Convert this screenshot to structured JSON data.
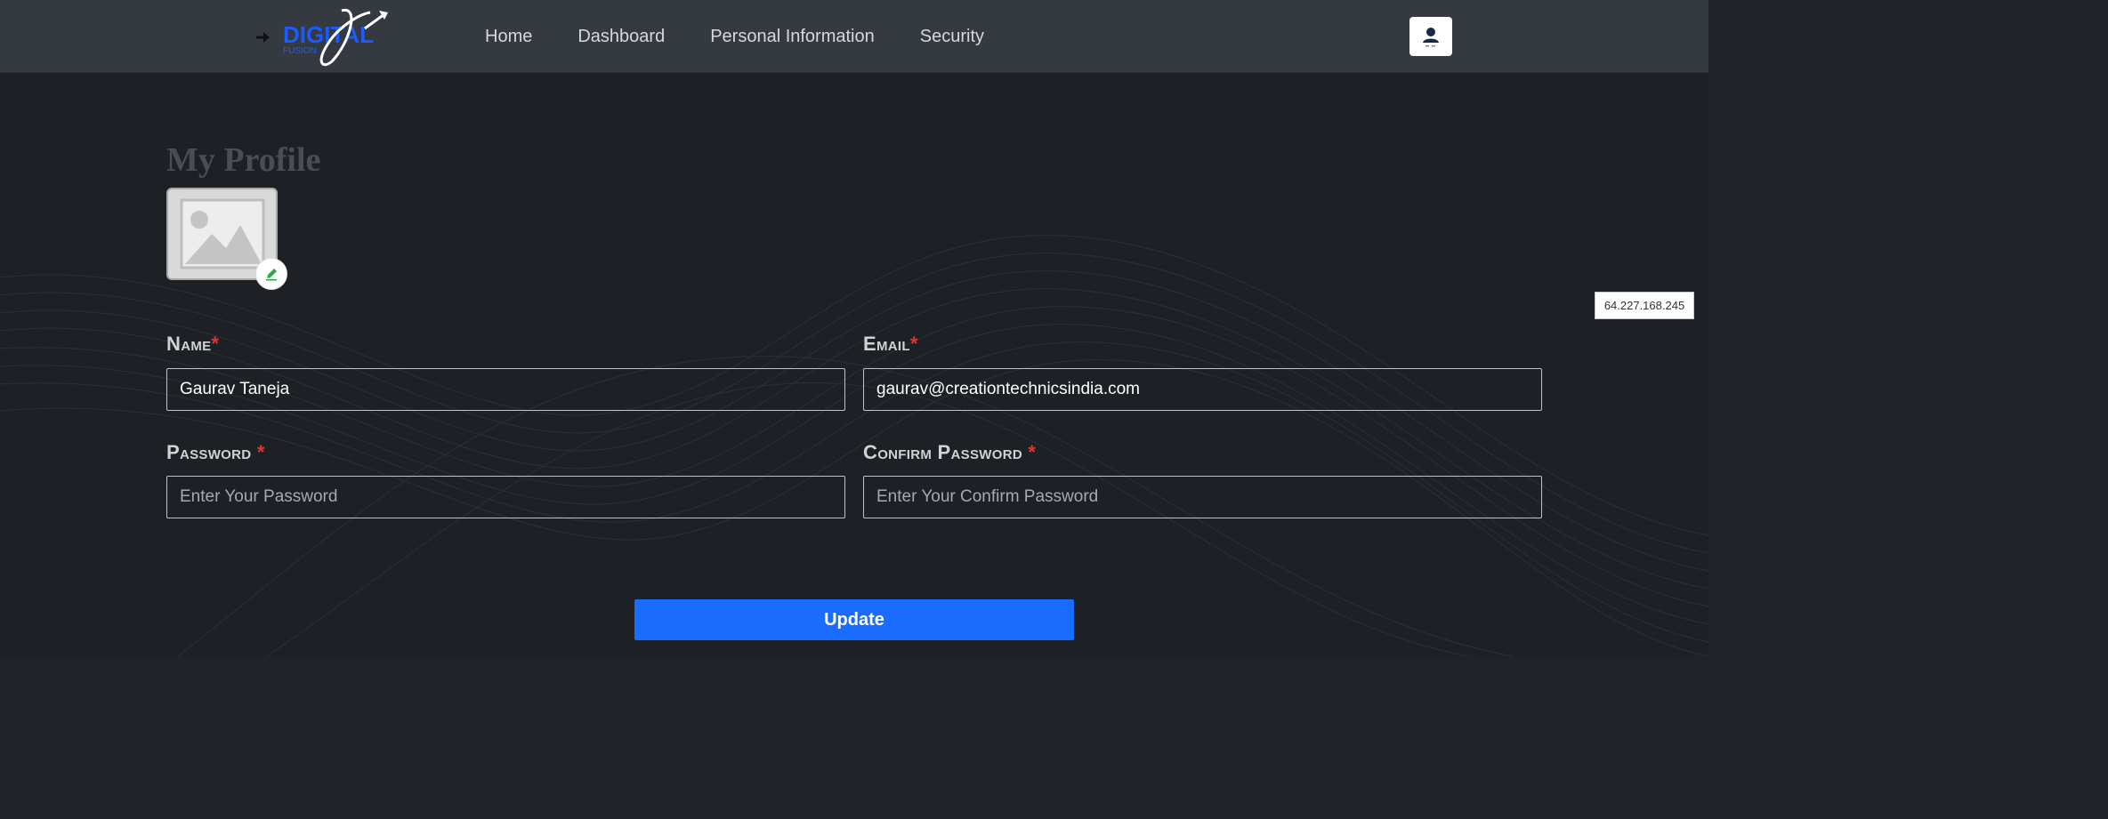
{
  "brand": {
    "logo_text": "DIGITAL",
    "logo_subtext": "FUSION"
  },
  "nav": {
    "items": [
      {
        "label": "Home"
      },
      {
        "label": "Dashboard"
      },
      {
        "label": "Personal Information"
      },
      {
        "label": "Security"
      }
    ]
  },
  "ip_address": "64.227.168.245",
  "profile": {
    "title": "My Profile",
    "fields": {
      "name": {
        "label": "Name",
        "value": "Gaurav Taneja"
      },
      "email": {
        "label": "Email",
        "value": "gaurav@creationtechnicsindia.com"
      },
      "password": {
        "label": "Password",
        "placeholder": "Enter Your Password"
      },
      "confirm_password": {
        "label": "Confirm Password",
        "placeholder": "Enter Your Confirm Password"
      }
    },
    "required_mark": "*",
    "update_label": "Update"
  },
  "colors": {
    "header_bg": "#353a40",
    "page_bg": "#1d2024",
    "accent": "#1a6cff",
    "required": "#e03434"
  },
  "icons": {
    "logo": "digital-fusion-logo-icon",
    "user": "user-icon",
    "avatar_placeholder": "image-placeholder-icon",
    "edit": "pencil-icon"
  }
}
